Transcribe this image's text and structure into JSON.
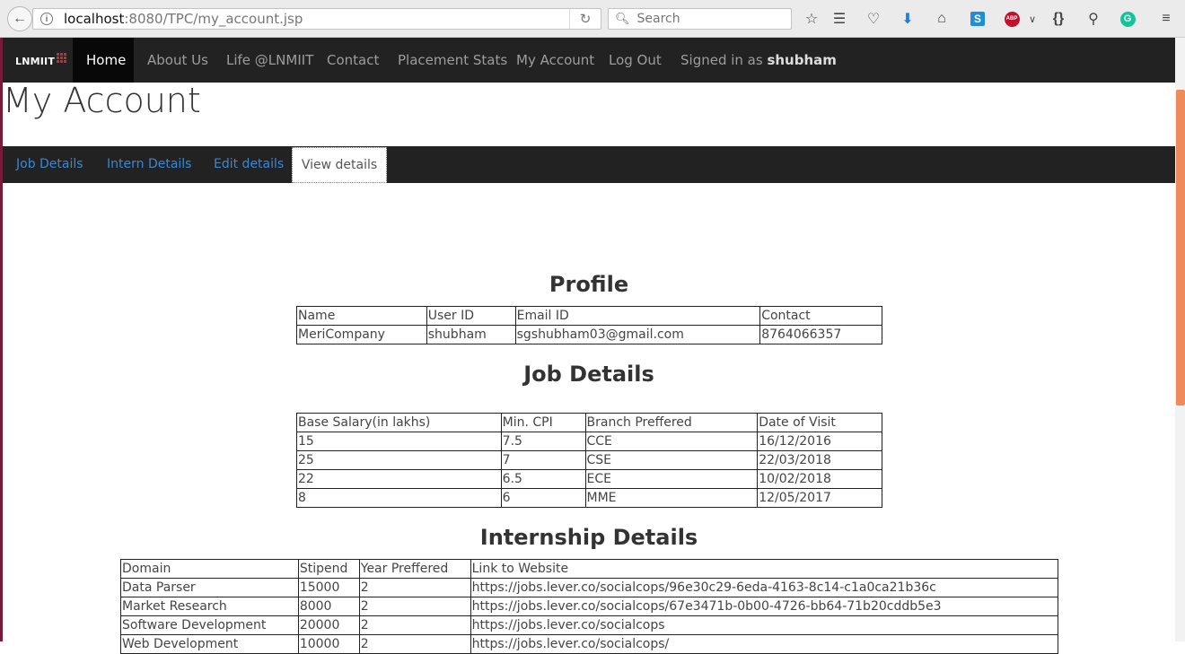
{
  "browser": {
    "url_host": "localhost",
    "url_rest": ":8080/TPC/my_account.jsp",
    "search_placeholder": "Search"
  },
  "navbar": {
    "brand": "LNMIIT",
    "items": [
      "Home",
      "About Us",
      "Life @LNMIIT",
      "Contact",
      "Placement Stats",
      "My Account",
      "Log Out"
    ],
    "signed_in_prefix": "Signed in as ",
    "username": "shubham"
  },
  "page_title": "My Account",
  "tabs": [
    "Job Details",
    "Intern Details",
    "Edit details",
    "View details"
  ],
  "profile": {
    "heading": "Profile",
    "columns": [
      "Name",
      "User ID",
      "Email ID",
      "Contact"
    ],
    "rows": [
      [
        "MeriCompany",
        "shubham",
        "sgshubham03@gmail.com",
        "8764066357"
      ]
    ]
  },
  "job_details": {
    "heading": "Job Details",
    "columns": [
      "Base Salary(in lakhs)",
      "Min. CPI",
      "Branch Preffered",
      "Date of Visit"
    ],
    "rows": [
      [
        "15",
        "7.5",
        "CCE",
        "16/12/2016"
      ],
      [
        "25",
        "7",
        "CSE",
        "22/03/2018"
      ],
      [
        "22",
        "6.5",
        "ECE",
        "10/02/2018"
      ],
      [
        "8",
        "6",
        "MME",
        "12/05/2017"
      ]
    ]
  },
  "internship_details": {
    "heading": "Internship Details",
    "columns": [
      "Domain",
      "Stipend",
      "Year Preffered",
      "Link to Website"
    ],
    "rows": [
      [
        "Data Parser",
        "15000",
        "2",
        "https://jobs.lever.co/socialcops/96e30c29-6eda-4163-8c14-c1a0ca21b36c"
      ],
      [
        "Market Research",
        "8000",
        "2",
        "https://jobs.lever.co/socialcops/67e3471b-0b00-4726-bb64-71b20cddb5e3"
      ],
      [
        "Software Development",
        "20000",
        "2",
        "https://jobs.lever.co/socialcops"
      ],
      [
        "Web Development",
        "10000",
        "2",
        "https://jobs.lever.co/socialcops/"
      ]
    ]
  },
  "colors": {
    "navbar_bg": "#222222",
    "link_blue": "#3a87d6",
    "scroll_thumb": "#ef8a5a",
    "page_border": "#7a1a3a"
  }
}
